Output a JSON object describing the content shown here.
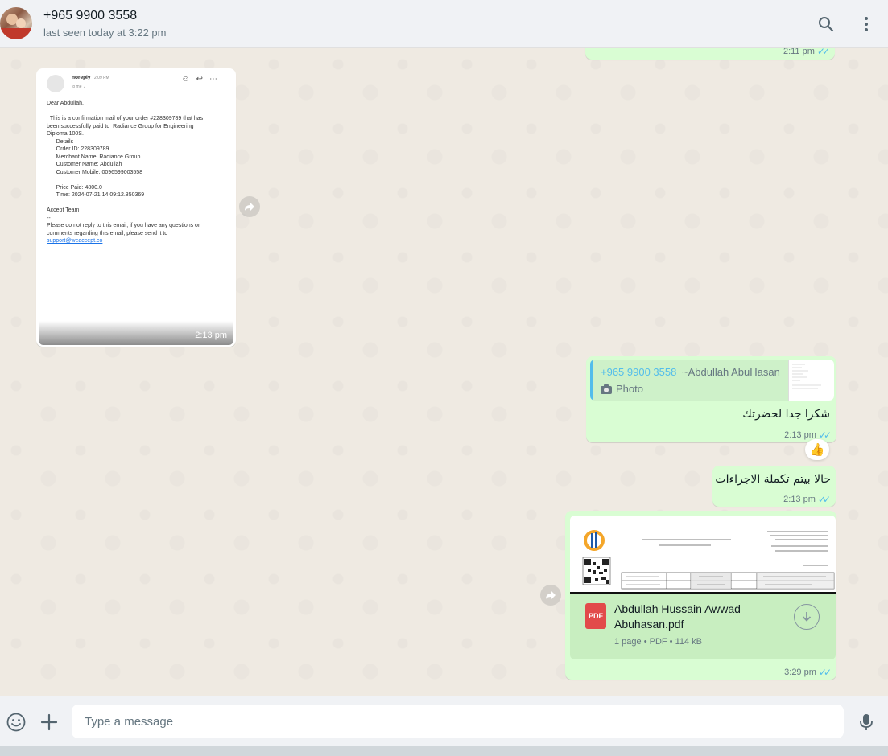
{
  "header": {
    "contact_name": "+965 9900 3558",
    "status": "last seen today at 3:22 pm",
    "icons": [
      "search-icon",
      "menu-dots-icon"
    ]
  },
  "messages": {
    "top_partial": {
      "time": "2:11 pm"
    },
    "email_screenshot": {
      "sender": "noreply",
      "sent_time": "2:09 PM",
      "to": "to me ⌄",
      "body": "Dear Abdullah,\n\n  This is a confirmation mail of your order #228309789 that has\nbeen successfully paid to  Radiance Group for Engineering\nDiploma 100S.\n      Details\n      Order ID: 228309789\n      Merchant Name: Radiance Group\n      Customer Name: Abdullah\n      Customer Mobile: 0096599003558\n\n      Price Paid: 4800.0\n      Time: 2024-07-21 14:09:12.850369\n\nAccept Team\n--\nPlease do not reply to this email, if you have any questions or\ncomments regarding this email, please send it to",
      "link": "support@weaccept.co",
      "time": "2:13 pm"
    },
    "reply_msg": {
      "quote_name": "+965 9900 3558",
      "quote_alias": "~Abdullah AbuHasan",
      "quote_type": "Photo",
      "text": "شكرا جدا لحضرتك",
      "time": "2:13 pm",
      "reaction": "👍"
    },
    "msg2": {
      "text": "حالا بيتم تكملة الاجراءات",
      "time": "2:13 pm"
    },
    "pdf_msg": {
      "file_name": "Abdullah Hussain Awwad Abuhasan.pdf",
      "file_name_line1": "Abdullah Hussain Awwad",
      "file_name_line2": "Abuhasan.pdf",
      "file_meta": "1 page • PDF • 114 kB",
      "icon_label": "PDF",
      "time": "3:29 pm"
    }
  },
  "composer": {
    "placeholder": "Type a message",
    "icons": [
      "emoji-icon",
      "plus-icon",
      "mic-icon"
    ]
  },
  "colors": {
    "outgoing_bubble": "#d9fdd3",
    "incoming_bubble": "#ffffff",
    "read_ticks": "#53bdeb",
    "chat_bg": "#efeae2",
    "pdf_red": "#e24a4a"
  }
}
